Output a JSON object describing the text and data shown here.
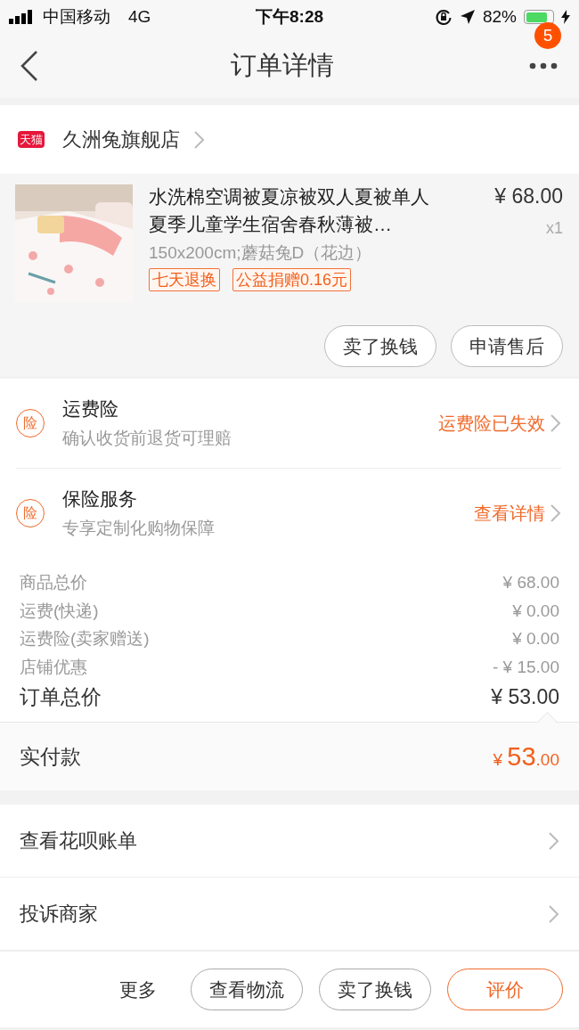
{
  "status_bar": {
    "carrier": "中国移动",
    "network": "4G",
    "time": "下午8:28",
    "battery": "82%"
  },
  "nav": {
    "title": "订单详情",
    "badge": "5"
  },
  "store": {
    "badge": "天猫",
    "name": "久洲兔旗舰店"
  },
  "product": {
    "title": "水洗棉空调被夏凉被双人夏被单人夏季儿童学生宿舍春秋薄被…",
    "price": "¥ 68.00",
    "quantity": "x1",
    "sku": "150x200cm;蘑菇兔D（花边）",
    "tags": [
      "七天退换",
      "公益捐赠0.16元"
    ],
    "buttons": [
      "卖了换钱",
      "申请售后"
    ]
  },
  "insurance": [
    {
      "icon": "险",
      "title": "运费险",
      "subtitle": "确认收货前退货可理赔",
      "action": "运费险已失效"
    },
    {
      "icon": "险",
      "title": "保险服务",
      "subtitle": "专享定制化购物保障",
      "action": "查看详情"
    }
  ],
  "summary": [
    {
      "label": "商品总价",
      "value": "¥ 68.00",
      "kind": "item"
    },
    {
      "label": "运费(快递)",
      "value": "¥ 0.00",
      "kind": "item"
    },
    {
      "label": "运费险(卖家赠送)",
      "value": "¥ 0.00",
      "kind": "item"
    },
    {
      "label": "店铺优惠",
      "value": "- ¥ 15.00",
      "kind": "item"
    },
    {
      "label": "订单总价",
      "value": "¥ 53.00",
      "kind": "total"
    }
  ],
  "paid": {
    "label": "实付款",
    "currency": "¥",
    "integer": "53",
    "decimal": ".00"
  },
  "links": [
    "查看花呗账单",
    "投诉商家"
  ],
  "actions": [
    {
      "label": "更多",
      "kind": "text"
    },
    {
      "label": "查看物流",
      "kind": "outline"
    },
    {
      "label": "卖了换钱",
      "kind": "outline"
    },
    {
      "label": "评价",
      "kind": "primary"
    }
  ]
}
